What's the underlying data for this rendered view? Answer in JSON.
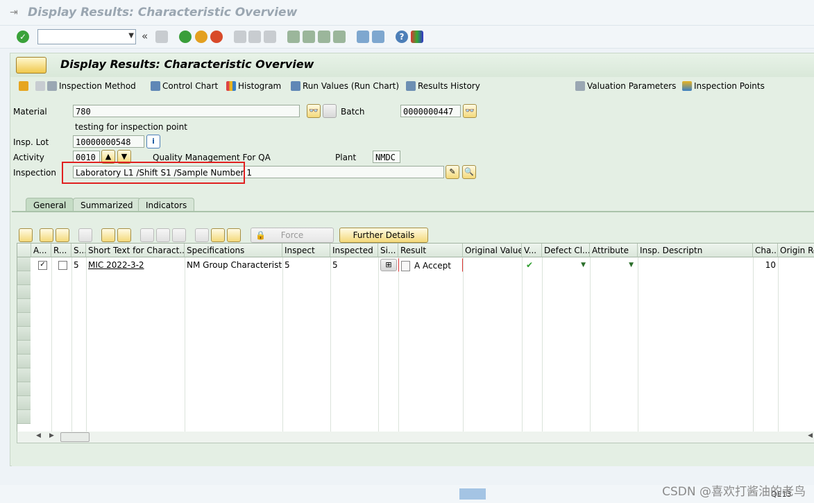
{
  "window": {
    "title": "Display Results: Characteristic Overview"
  },
  "app": {
    "title": "Display Results: Characteristic Overview"
  },
  "app_toolbar": {
    "inspection_method": "Inspection Method",
    "control_chart": "Control Chart",
    "histogram": "Histogram",
    "run_values": "Run Values (Run Chart)",
    "results_history": "Results History",
    "valuation_parameters": "Valuation Parameters",
    "inspection_points": "Inspection Points"
  },
  "header": {
    "material_label": "Material",
    "material_value": "780",
    "material_desc": "testing for inspection point",
    "batch_label": "Batch",
    "batch_value": "0000000447",
    "insp_lot_label": "Insp. Lot",
    "insp_lot_value": "10000000548",
    "activity_label": "Activity",
    "activity_value": "0010",
    "activity_desc": "Quality Management For QA",
    "plant_label": "Plant",
    "plant_value": "NMDC",
    "inspection_label": "Inspection",
    "inspection_value": "Laboratory L1 /Shift S1 /Sample Number 1"
  },
  "tabs": [
    {
      "label": "General",
      "active": true
    },
    {
      "label": "Summarized",
      "active": false
    },
    {
      "label": "Indicators",
      "active": false
    }
  ],
  "alv_toolbar": {
    "force": "Force",
    "further_details": "Further Details"
  },
  "grid": {
    "columns": [
      "A...",
      "R...",
      "S...",
      "Short Text for Charact...",
      "Specifications",
      "Inspect",
      "Inspected",
      "Si...",
      "Result",
      "Original Value",
      "V...",
      "Defect Cl...",
      "Attribute",
      "Insp. Descriptn",
      "Cha...",
      "Origin Re"
    ],
    "rows": [
      {
        "a_checked": true,
        "r_checked": false,
        "s": "5",
        "short_text": "MIC 2022-3-2",
        "specifications": "NM Group Characteristic ...",
        "inspect": "5",
        "inspected": "5",
        "result": "A Accept",
        "original_value": "",
        "defect_class": "",
        "attribute": "",
        "insp_desc": "",
        "cha": "10"
      }
    ]
  },
  "status": {
    "transaction": "QE13"
  },
  "watermark": "CSDN @喜欢打酱油的老鸟",
  "colors": {
    "accent_green": "#2e9e2e",
    "highlight_red": "#e02020",
    "button_yellow": "#f4d97a"
  }
}
